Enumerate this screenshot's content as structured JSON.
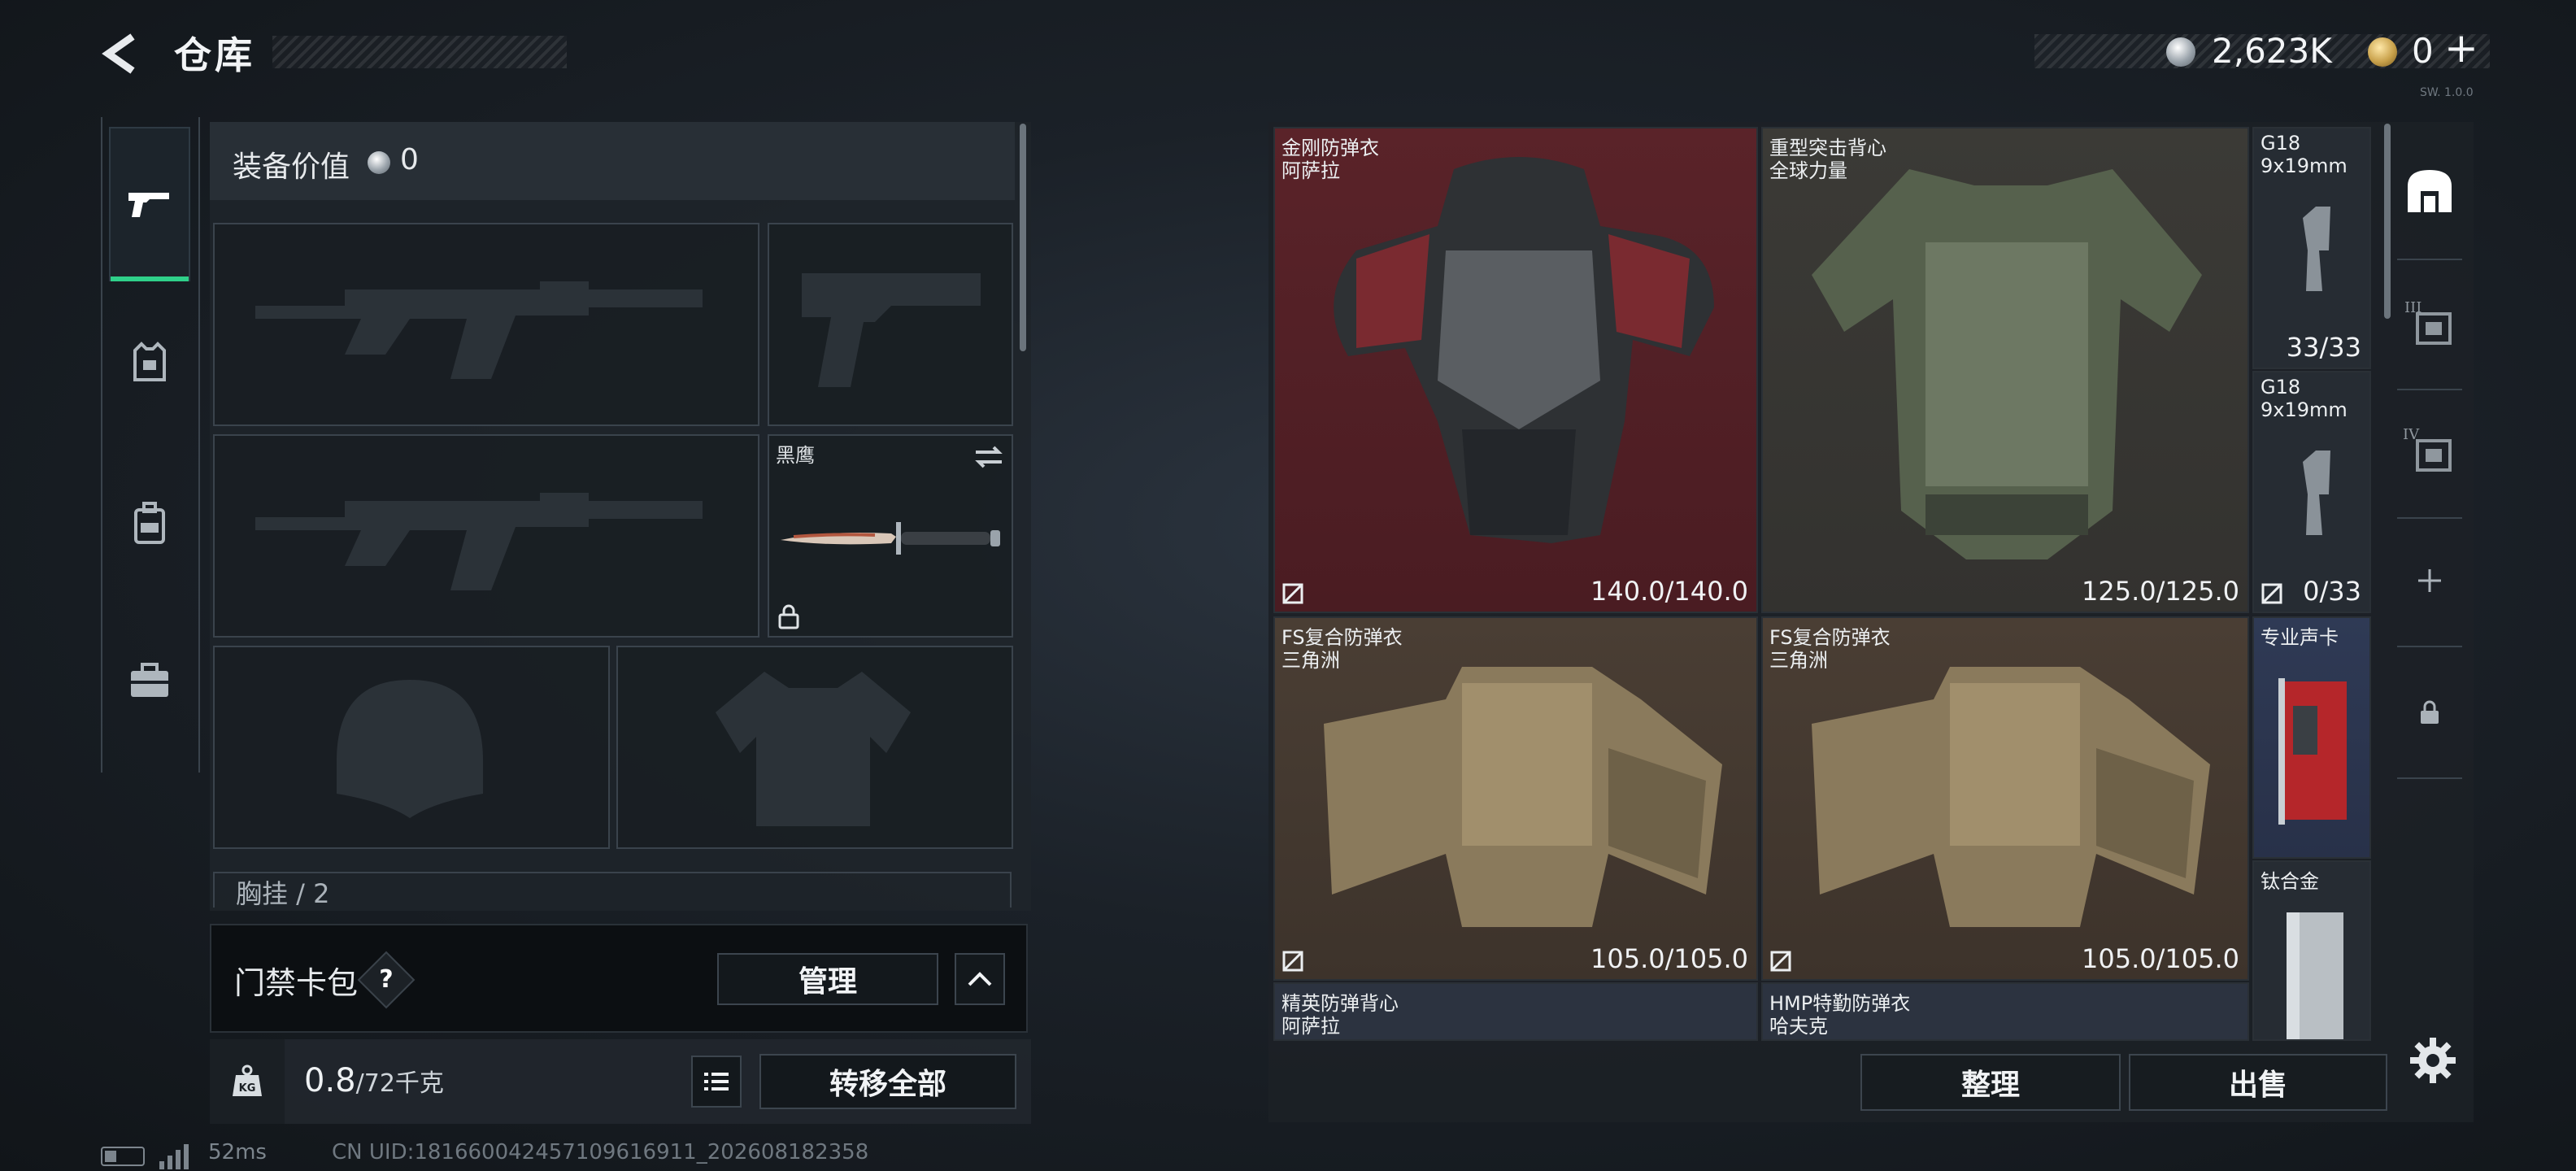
{
  "header": {
    "title": "仓库",
    "currency_primary": "2,623K",
    "currency_secondary": "0",
    "currency_add": "+",
    "version": "SW. 1.0.0"
  },
  "left_tabs": [
    "weapons",
    "vest",
    "backpack",
    "case"
  ],
  "loadout": {
    "value_label": "装备价值",
    "value": "0",
    "knife_name": "黑鹰",
    "chest_row_label": "胸挂 / 2"
  },
  "keycard": {
    "label": "门禁卡包",
    "help": "?",
    "manage_label": "管理"
  },
  "weight": {
    "current": "0.8",
    "limit": "/72千克",
    "kg_icon_text": "KG",
    "transfer_all_label": "转移全部"
  },
  "status": {
    "ping": "52ms",
    "uid": "CN UID:181660042457109616911_202608182358"
  },
  "stash": {
    "items": [
      {
        "name": "金刚防弹衣",
        "sub": "阿萨拉",
        "durability": "140.0/140.0",
        "rarity": "red"
      },
      {
        "name": "重型突击背心",
        "sub": "全球力量",
        "durability": "125.0/125.0",
        "rarity": "green"
      },
      {
        "name": "G18",
        "sub": "9x19mm",
        "ammo": "33/33"
      },
      {
        "name": "G18",
        "sub": "9x19mm",
        "ammo": "0/33"
      },
      {
        "name": "FS复合防弹衣",
        "sub": "三角洲",
        "durability": "105.0/105.0",
        "rarity": "brown"
      },
      {
        "name": "FS复合防弹衣",
        "sub": "三角洲",
        "durability": "105.0/105.0",
        "rarity": "brown"
      },
      {
        "name": "专业声卡",
        "rarity": "blue"
      },
      {
        "name": "钛合金"
      },
      {
        "name": "精英防弹背心",
        "sub": "阿萨拉"
      },
      {
        "name": "HMP特勤防弹衣",
        "sub": "哈夫克"
      }
    ],
    "sort_label": "整理",
    "sell_label": "出售"
  },
  "right_tabs": [
    "stash-main",
    "III",
    "IV",
    "+",
    "lock"
  ],
  "colors": {
    "accent_green": "#2fd08a",
    "rarity_red": "#5a2329",
    "rarity_brown": "#4a3e34",
    "rarity_blue": "#2f3a55"
  }
}
